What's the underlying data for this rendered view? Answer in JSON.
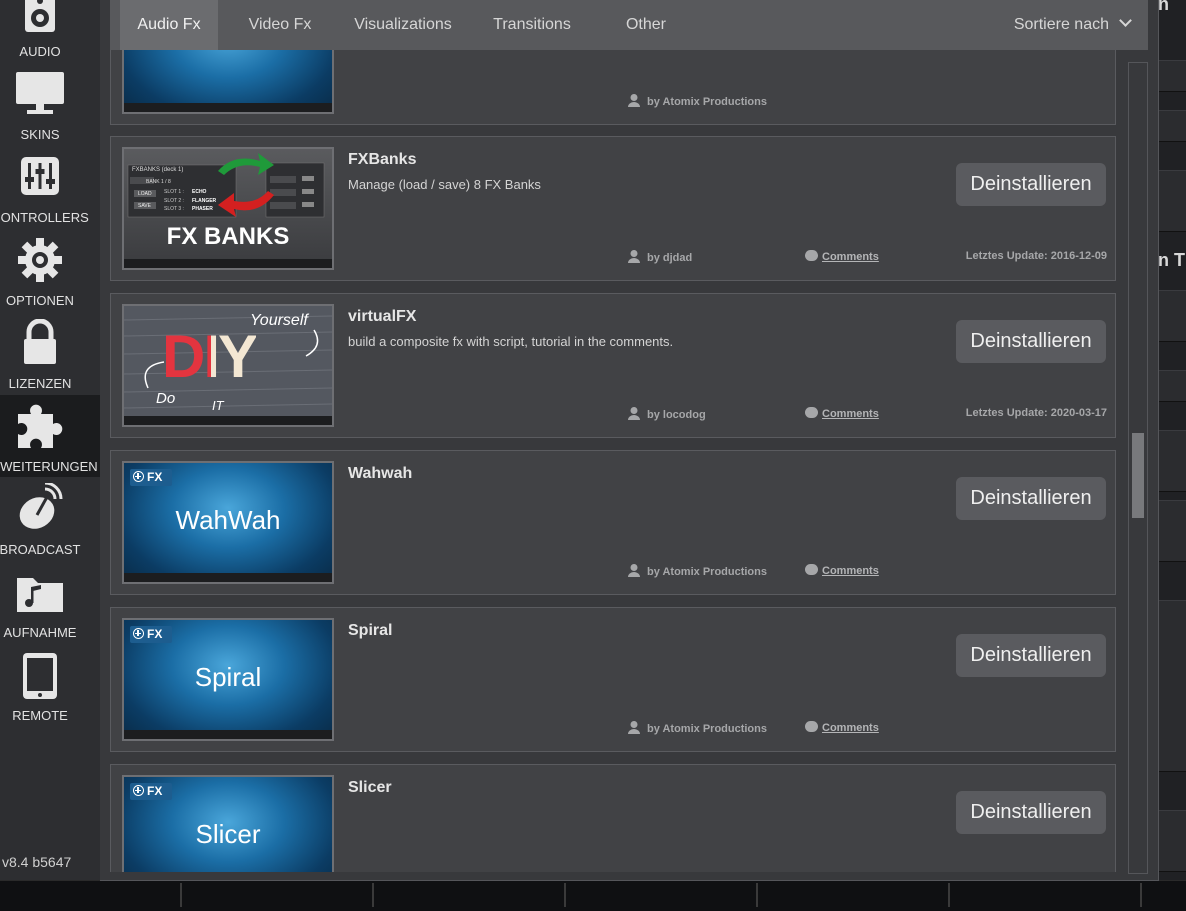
{
  "sidebar": {
    "items": [
      {
        "label": "AUDIO",
        "icon": "speaker-icon"
      },
      {
        "label": "SKINS",
        "icon": "monitor-icon"
      },
      {
        "label": "CONTROLLERS",
        "icon": "sliders-icon"
      },
      {
        "label": "OPTIONEN",
        "icon": "gear-icon"
      },
      {
        "label": "LIZENZEN",
        "icon": "lock-icon"
      },
      {
        "label": "ERWEITERUNGEN",
        "icon": "puzzle-icon"
      },
      {
        "label": "BROADCAST",
        "icon": "satellite-dish-icon"
      },
      {
        "label": "AUFNAHME",
        "icon": "music-folder-icon"
      },
      {
        "label": "REMOTE",
        "icon": "tablet-icon"
      }
    ],
    "active_index": 5,
    "version": "v8.4 b5647"
  },
  "tabs": {
    "items": [
      "Audio Fx",
      "Video Fx",
      "Visualizations",
      "Transitions",
      "Other"
    ],
    "active_index": 0,
    "sort_label": "Sortiere nach"
  },
  "background": {
    "snippets": [
      "n",
      "n T",
      "n",
      "n"
    ]
  },
  "plugins": {
    "comments_label": "Comments",
    "button_label": "Deinstallieren",
    "items": [
      {
        "title": "",
        "desc": "",
        "author": "by Atomix Productions",
        "has_comments": false,
        "updated": "",
        "thumb": "fx",
        "thumb_text": "",
        "partial": true
      },
      {
        "title": "FXBanks",
        "desc": "Manage (load / save) 8 FX Banks",
        "author": "by djdad",
        "has_comments": true,
        "updated": "Letztes Update: 2016-12-09",
        "thumb": "fxbanks",
        "thumb_panel": {
          "header": "FXBANKS (deck 1)",
          "bank": "BANK 1 / 8",
          "load": "LOAD",
          "save": "SAVE",
          "slot1": "SLOT 1 :",
          "slot2": "SLOT 2 :",
          "slot3": "SLOT 3 :",
          "echo": "ECHO",
          "flanger": "FLANGER",
          "phaser": "PHASER",
          "big": "FX BANKS"
        }
      },
      {
        "title": "virtualFX",
        "desc": "build a composite fx with script, tutorial in the comments.",
        "author": "by locodog",
        "has_comments": true,
        "updated": "Letztes Update: 2020-03-17",
        "thumb": "diy",
        "thumb_words": {
          "big": "DIY",
          "yourself": "Yourself",
          "do": "Do",
          "it": "IT"
        }
      },
      {
        "title": "Wahwah",
        "desc": "",
        "author": "by Atomix Productions",
        "has_comments": true,
        "updated": "",
        "thumb": "fx",
        "thumb_text": "WahWah"
      },
      {
        "title": "Spiral",
        "desc": "",
        "author": "by Atomix Productions",
        "has_comments": true,
        "updated": "",
        "thumb": "fx",
        "thumb_text": "Spiral"
      },
      {
        "title": "Slicer",
        "desc": "",
        "author": "",
        "has_comments": false,
        "updated": "",
        "thumb": "fx",
        "thumb_text": "Slicer"
      }
    ]
  },
  "fx_badge": "FX"
}
